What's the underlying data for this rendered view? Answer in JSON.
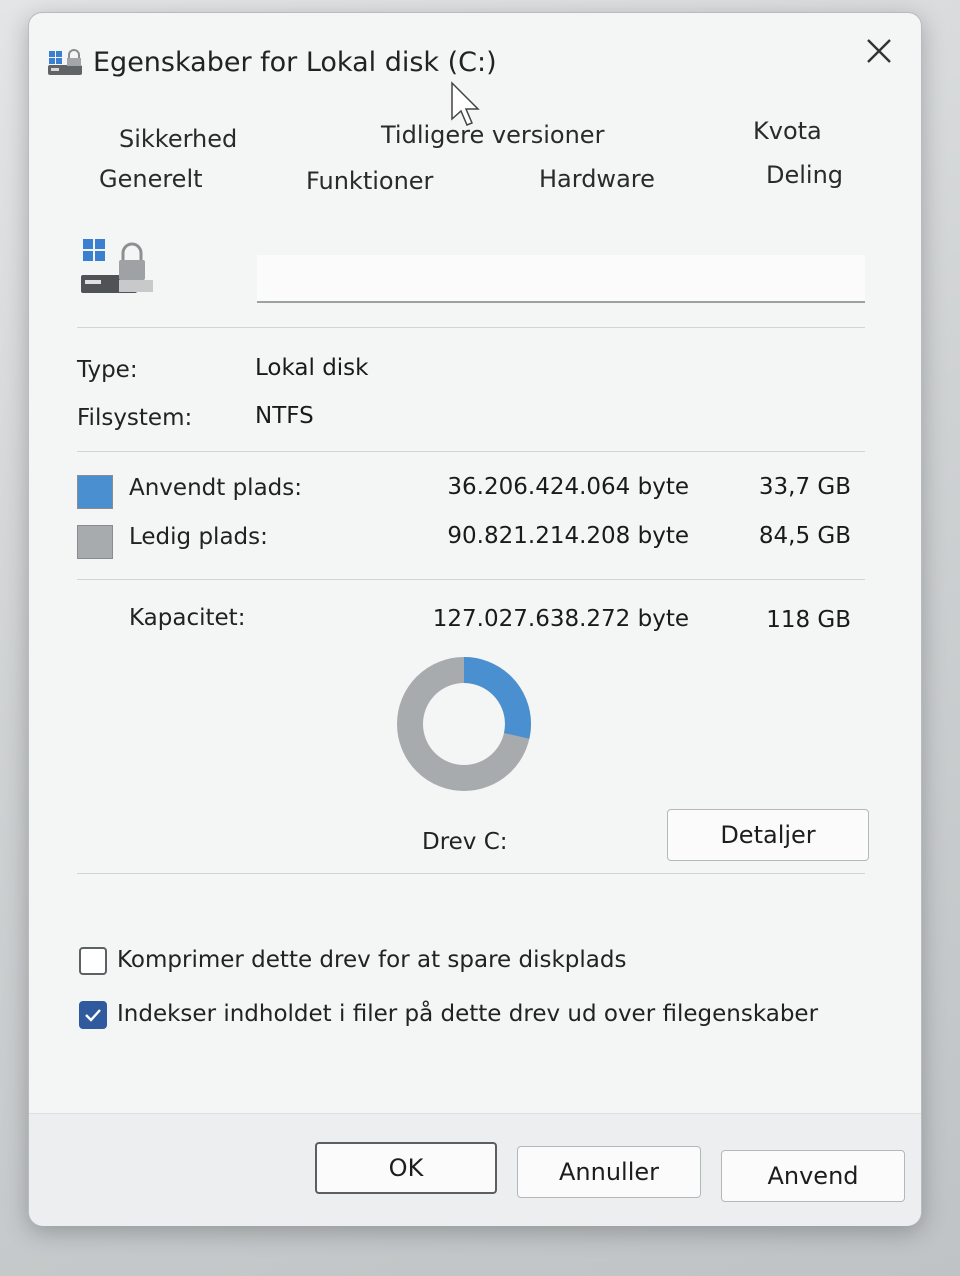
{
  "window": {
    "title": "Egenskaber for Lokal disk (C:)",
    "close_icon": "close-icon",
    "title_icon": "drive-icon"
  },
  "tabs": {
    "row1": [
      "Sikkerhed",
      "Tidligere versioner",
      "Kvota"
    ],
    "row2": [
      "Generelt",
      "Funktioner",
      "Hardware",
      "Deling"
    ],
    "active": "Generelt"
  },
  "general": {
    "name_value": "",
    "type_label": "Type:",
    "type_value": "Lokal disk",
    "fs_label": "Filsystem:",
    "fs_value": "NTFS"
  },
  "usage": {
    "used": {
      "label": "Anvendt plads:",
      "bytes": "36.206.424.064 byte",
      "size": "33,7 GB",
      "color": "#4a90d0"
    },
    "free": {
      "label": "Ledig plads:",
      "bytes": "90.821.214.208 byte",
      "size": "84,5 GB",
      "color": "#a8abad"
    },
    "capacity": {
      "label": "Kapacitet:",
      "bytes": "127.027.638.272 byte",
      "size": "118 GB"
    },
    "used_fraction": 0.285
  },
  "drive_label": "Drev C:",
  "details_button": "Detaljer",
  "options": {
    "compress": {
      "label": "Komprimer dette drev for at spare diskplads",
      "checked": false
    },
    "index": {
      "label": "Indekser indholdet i filer på dette drev ud over filegenskaber",
      "checked": true
    }
  },
  "buttons": {
    "ok": "OK",
    "cancel": "Annuller",
    "apply": "Anvend"
  }
}
